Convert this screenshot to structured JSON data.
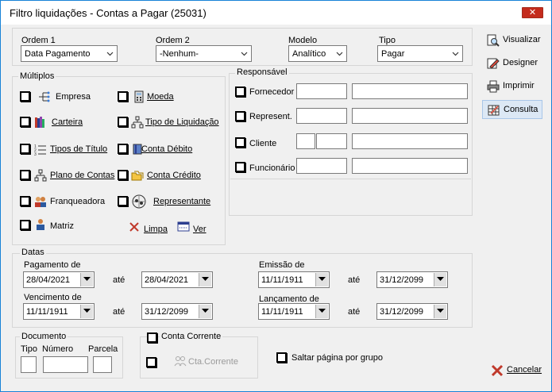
{
  "window": {
    "title": "Filtro liquidações - Contas a Pagar (25031)",
    "close_glyph": "✕"
  },
  "top": {
    "ordem1": {
      "label": "Ordem 1",
      "value": "Data Pagamento"
    },
    "ordem2": {
      "label": "Ordem 2",
      "value": "-Nenhum-"
    },
    "modelo": {
      "label": "Modelo",
      "value": "Analítico"
    },
    "tipo": {
      "label": "Tipo",
      "value": "Pagar"
    }
  },
  "multiplos": {
    "title": "Múltiplos",
    "items": {
      "empresa": "Empresa",
      "moeda": "Moeda",
      "carteira": "Carteira",
      "tipo_liquidacao": "Tipo de Liquidação",
      "tipos_titulo": "Tipos de Título",
      "conta_debito": "Conta Débito",
      "plano_contas": "Plano de Contas",
      "conta_credito": "Conta Crédito",
      "franqueadora": "Franqueadora",
      "representante": "Representante",
      "matriz": "Matriz"
    },
    "limpa": "Limpa",
    "ver": "Ver"
  },
  "responsavel": {
    "title": "Responsável",
    "fornecedor": "Fornecedor",
    "represent": "Represent.",
    "cliente": "Cliente",
    "funcionario": "Funcionário"
  },
  "datas": {
    "title": "Datas",
    "ate": "até",
    "pagamento": {
      "label": "Pagamento de",
      "from": "28/04/2021",
      "to": "28/04/2021"
    },
    "vencimento": {
      "label": "Vencimento de",
      "from": "11/11/1911",
      "to": "31/12/2099"
    },
    "emissao": {
      "label": "Emissão de",
      "from": "11/11/1911",
      "to": "31/12/2099"
    },
    "lancamento": {
      "label": "Lançamento de",
      "from": "11/11/1911",
      "to": "31/12/2099"
    }
  },
  "documento": {
    "title": "Documento",
    "tipo": "Tipo",
    "numero": "Número",
    "parcela": "Parcela"
  },
  "conta_corrente": {
    "title": "Conta Corrente",
    "button": "Cta.Corrente"
  },
  "saltar": "Saltar página por grupo",
  "side": {
    "visualizar": "Visualizar",
    "designer": "Designer",
    "imprimir": "Imprimir",
    "consulta": "Consulta",
    "cancelar": "Cancelar"
  }
}
